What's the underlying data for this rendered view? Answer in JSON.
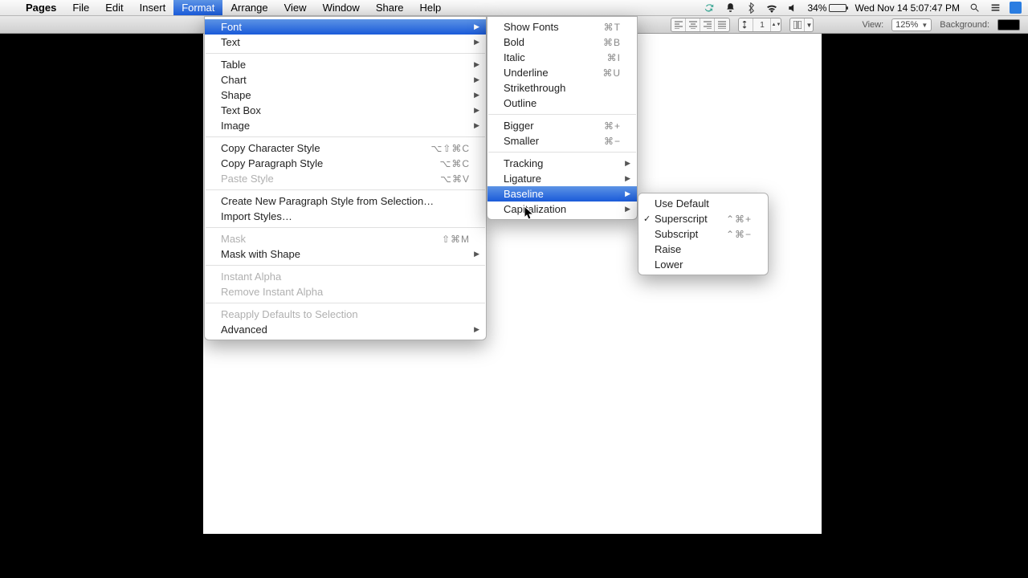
{
  "menubar": {
    "app": "Pages",
    "items": [
      "File",
      "Edit",
      "Insert",
      "Format",
      "Arrange",
      "View",
      "Window",
      "Share",
      "Help"
    ],
    "selected": "Format"
  },
  "status": {
    "battery_pct": "34%",
    "datetime": "Wed Nov 14  5:07:47 PM"
  },
  "toolbar": {
    "view_label": "View:",
    "zoom": "125%",
    "bg_label": "Background:",
    "linespacing_value": "1"
  },
  "format_menu": {
    "font": "Font",
    "text": "Text",
    "table": "Table",
    "chart": "Chart",
    "shape": "Shape",
    "textbox": "Text Box",
    "image": "Image",
    "copy_char": "Copy Character Style",
    "copy_char_sc": "⌥⇧⌘C",
    "copy_para": "Copy Paragraph Style",
    "copy_para_sc": "⌥⌘C",
    "paste_style": "Paste Style",
    "paste_style_sc": "⌥⌘V",
    "new_para": "Create New Paragraph Style from Selection…",
    "import_styles": "Import Styles…",
    "mask": "Mask",
    "mask_sc": "⇧⌘M",
    "mask_shape": "Mask with Shape",
    "instant_alpha": "Instant Alpha",
    "remove_alpha": "Remove Instant Alpha",
    "reapply": "Reapply Defaults to Selection",
    "advanced": "Advanced"
  },
  "font_menu": {
    "show_fonts": "Show Fonts",
    "show_fonts_sc": "⌘T",
    "bold": "Bold",
    "bold_sc": "⌘B",
    "italic": "Italic",
    "italic_sc": "⌘I",
    "underline": "Underline",
    "underline_sc": "⌘U",
    "strike": "Strikethrough",
    "outline": "Outline",
    "bigger": "Bigger",
    "bigger_sc": "⌘+",
    "smaller": "Smaller",
    "smaller_sc": "⌘−",
    "tracking": "Tracking",
    "ligature": "Ligature",
    "baseline": "Baseline",
    "capitalization": "Capitalization"
  },
  "baseline_menu": {
    "use_default": "Use Default",
    "superscript": "Superscript",
    "superscript_sc": "⌃⌘+",
    "subscript": "Subscript",
    "subscript_sc": "⌃⌘−",
    "raise": "Raise",
    "lower": "Lower",
    "checked": "Superscript"
  }
}
